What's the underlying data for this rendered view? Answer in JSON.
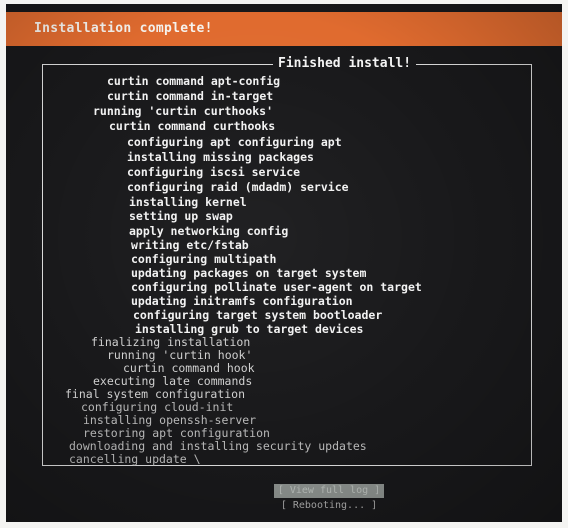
{
  "header": {
    "title": "Installation complete!"
  },
  "log": {
    "title": "Finished install!",
    "lines": [
      "curtin command apt-config",
      "curtin command in-target",
      "running 'curtin curthooks'",
      "curtin command curthooks",
      "configuring apt configuring apt",
      "installing missing packages",
      "configuring iscsi service",
      "configuring raid (mdadm) service",
      "installing kernel",
      "setting up swap",
      "apply networking config",
      "writing etc/fstab",
      "configuring multipath",
      "updating packages on target system",
      "configuring pollinate user-agent on target",
      "updating initramfs configuration",
      "configuring target system bootloader",
      "installing grub to target devices",
      "finalizing installation",
      "running 'curtin hook'",
      "curtin command hook",
      "executing late commands",
      "final system configuration",
      "configuring cloud-init",
      "installing openssh-server",
      "restoring apt configuration",
      "downloading and installing security updates",
      "cancelling update \\"
    ]
  },
  "buttons": {
    "view_log": "[ View full log ]",
    "reboot": "[ Rebooting... ]"
  }
}
